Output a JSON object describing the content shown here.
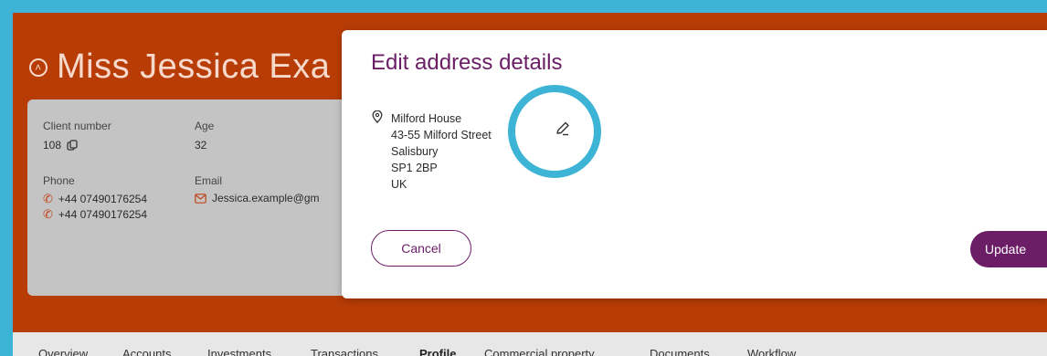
{
  "header": {
    "client_name": "Miss Jessica Exa",
    "collapse_icon": "chevron-up-circle-icon"
  },
  "client_card": {
    "client_number_label": "Client number",
    "client_number": "108",
    "age_label": "Age",
    "age": "32",
    "phone_label": "Phone",
    "phones": [
      "+44 07490176254",
      "+44 07490176254"
    ],
    "email_label": "Email",
    "email": "Jessica.example@gm"
  },
  "modal": {
    "title": "Edit address details",
    "address": [
      "Milford House",
      "43-55 Milford Street",
      "Salisbury",
      "SP1 2BP",
      "UK"
    ],
    "cancel_label": "Cancel",
    "update_label": "Update"
  },
  "tabs": [
    "Overview",
    "Accounts",
    "Investments",
    "Transactions",
    "Profile",
    "Commercial property",
    "Documents",
    "Workflow"
  ],
  "active_tab": "Profile",
  "colors": {
    "brand": "#b83c06",
    "modal_accent": "#6b1d66",
    "highlight": "#3db4d6"
  }
}
